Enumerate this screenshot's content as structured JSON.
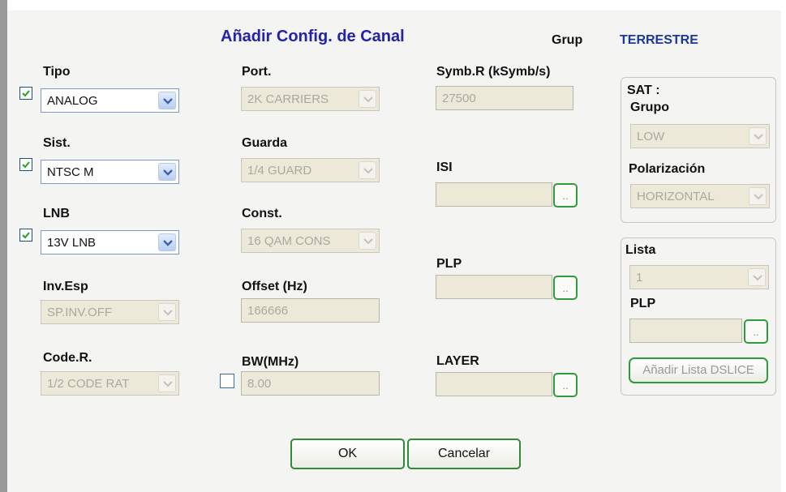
{
  "dialog": {
    "title": "Añadir Config. de Canal",
    "grup_label": "Grup",
    "grup_value": "TERRESTRE"
  },
  "col1": {
    "tipo_label": "Tipo",
    "tipo_value": "ANALOG",
    "sist_label": "Sist.",
    "sist_value": "NTSC M",
    "lnb_label": "LNB",
    "lnb_value": "13V LNB",
    "invesp_label": "Inv.Esp",
    "invesp_value": "SP.INV.OFF",
    "coder_label": "Code.R.",
    "coder_value": "1/2 CODE RAT"
  },
  "col2": {
    "port_label": "Port.",
    "port_value": "2K CARRIERS",
    "guarda_label": "Guarda",
    "guarda_value": "1/4 GUARD",
    "const_label": "Const.",
    "const_value": "16 QAM CONS",
    "offset_label": "Offset (Hz)",
    "offset_value": "166666",
    "bw_label": "BW(MHz)",
    "bw_value": "8.00"
  },
  "col3": {
    "symb_label": "Symb.R (kSymb/s)",
    "symb_value": "27500",
    "isi_label": "ISI",
    "plp_label": "PLP",
    "layer_label": "LAYER",
    "ellipsis": ".."
  },
  "sat_panel": {
    "title": "SAT :",
    "grupo_label": "Grupo",
    "grupo_value": "LOW",
    "pol_label": "Polarización",
    "pol_value": "HORIZONTAL"
  },
  "lista_panel": {
    "lista_label": "Lista",
    "lista_value": "1",
    "plp_label": "PLP",
    "add_button": "Añadir Lista DSLICE"
  },
  "buttons": {
    "ok": "OK",
    "cancel": "Cancelar"
  },
  "colors": {
    "title": "#2222aa",
    "accent_green": "#2f8a3a",
    "disabled_bg": "#ece9d8"
  }
}
